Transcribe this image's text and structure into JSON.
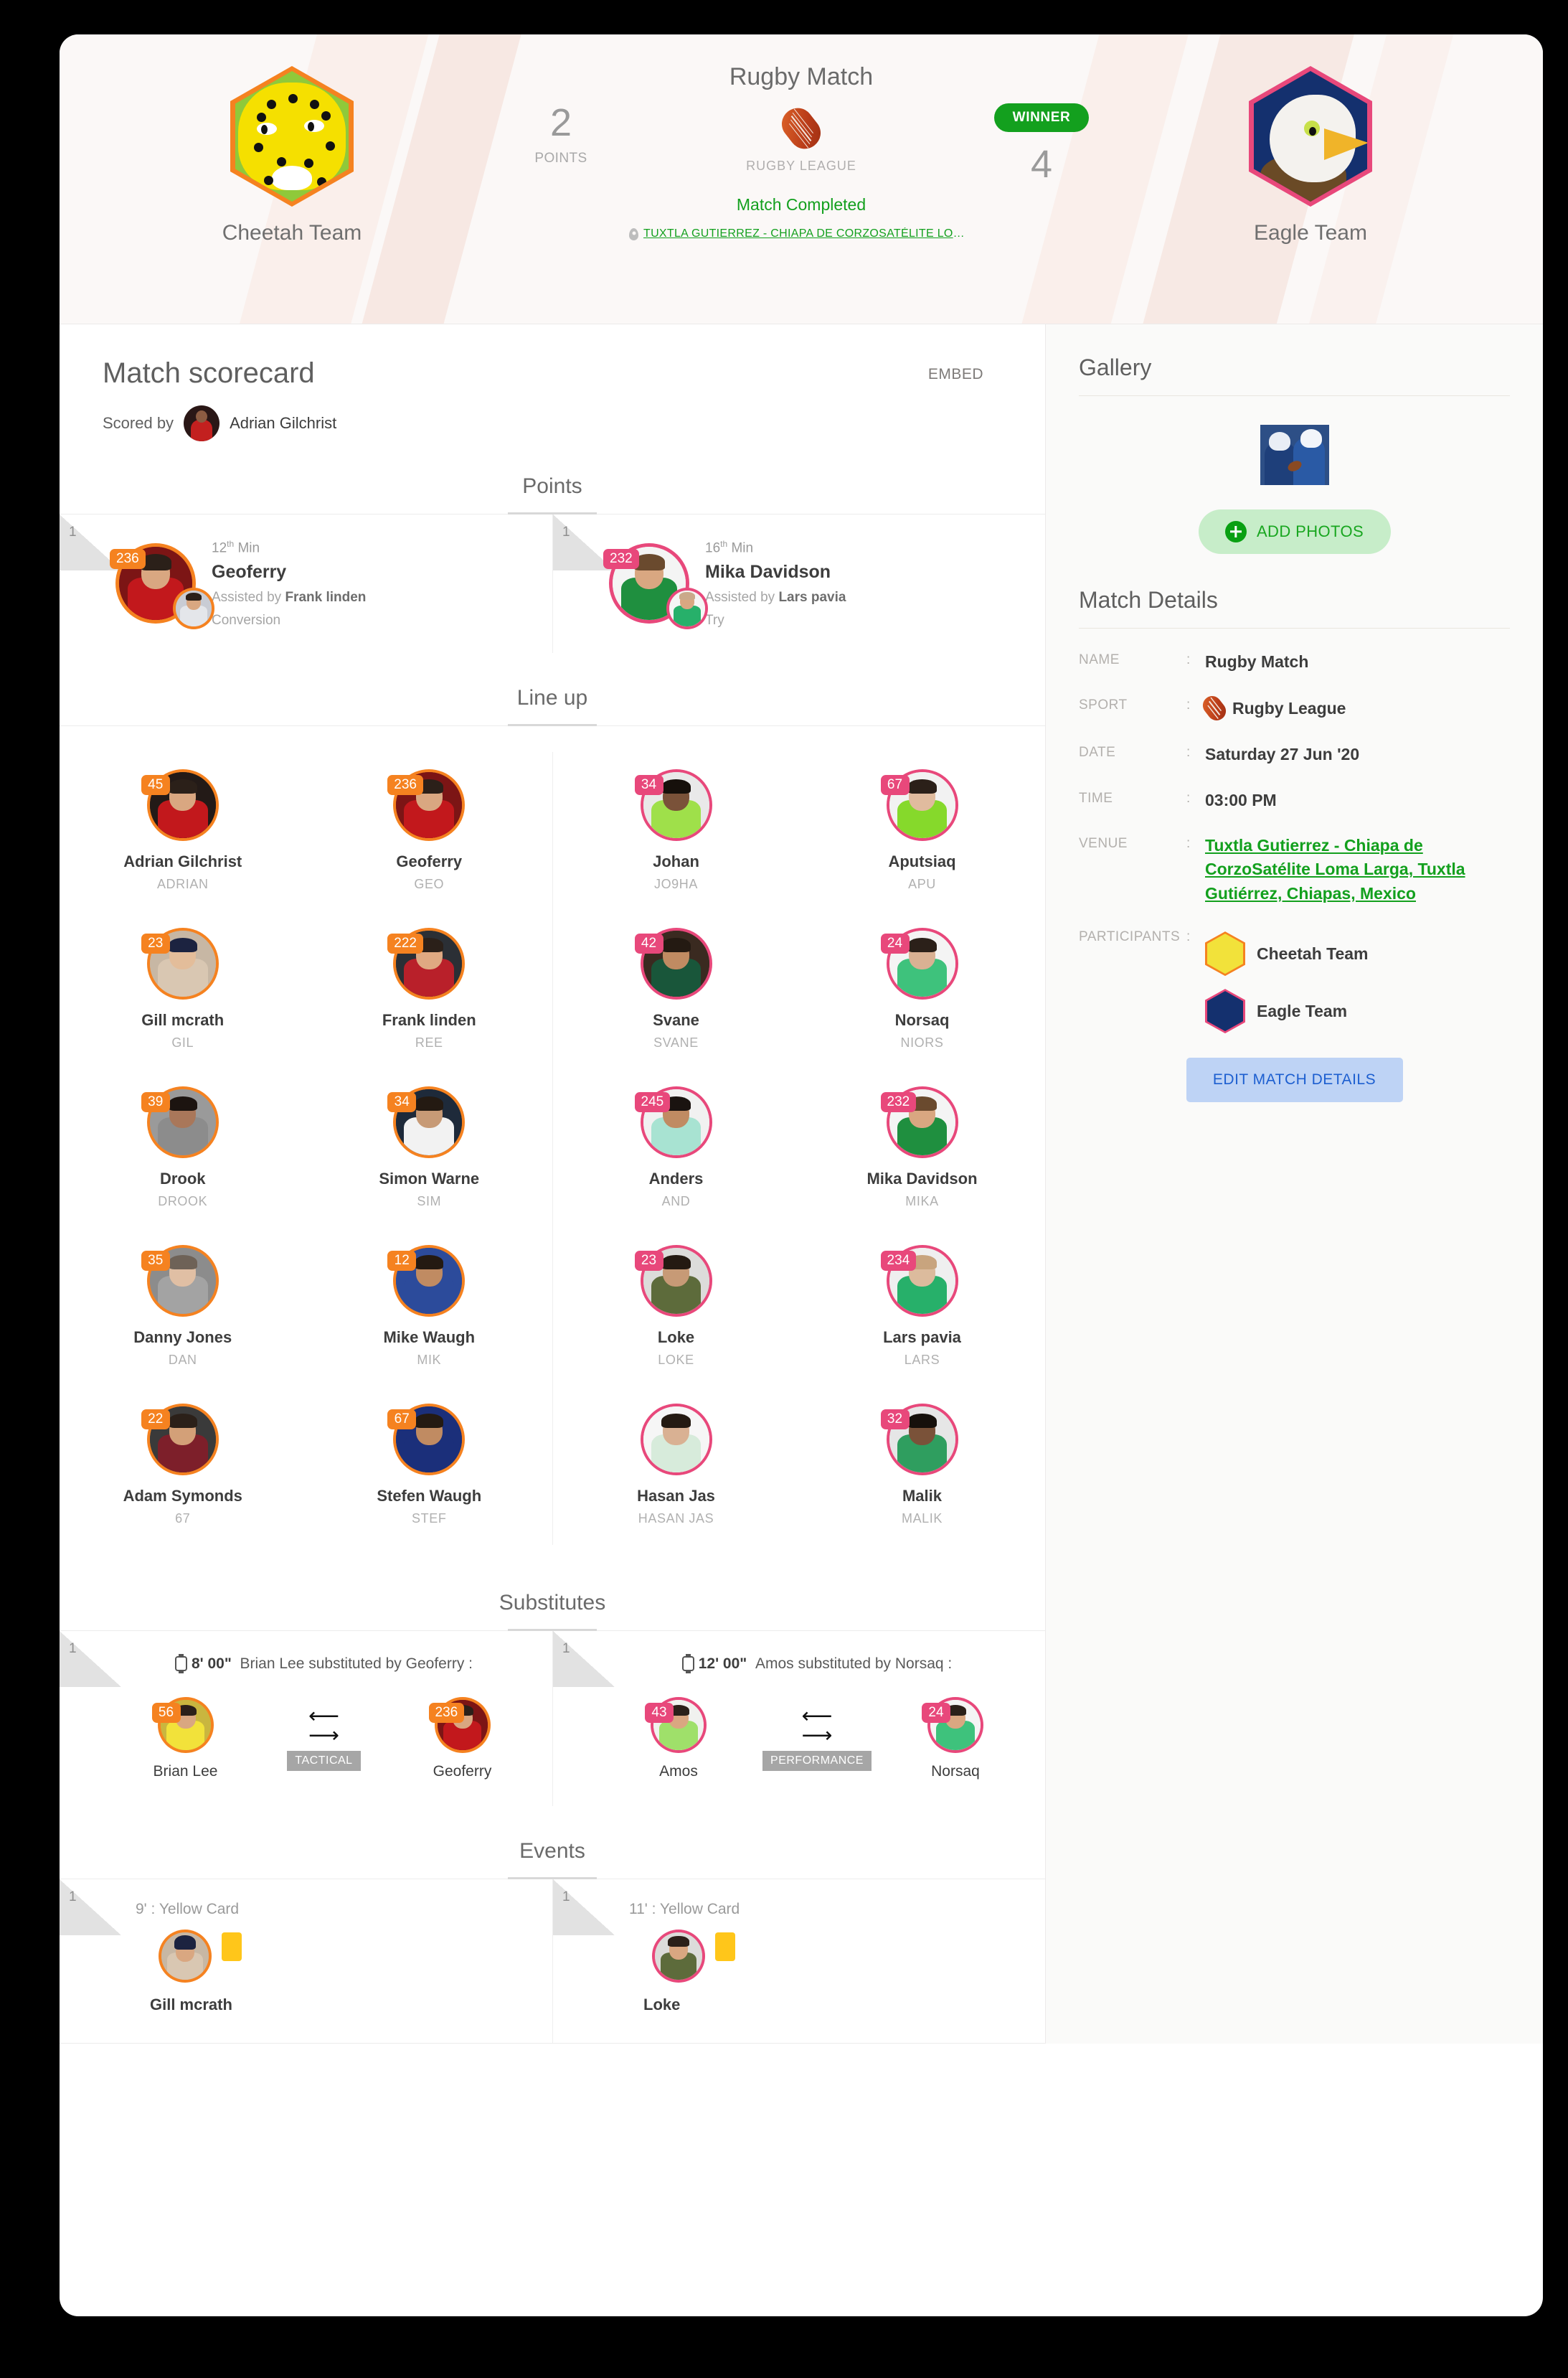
{
  "hero": {
    "match_title": "Rugby Match",
    "sport_label": "RUGBY LEAGUE",
    "status": "Match Completed",
    "venue_short": "TUXTLA GUTIERREZ - CHIAPA DE CORZOSATÉLITE LOMA LARG...",
    "winner_label": "WINNER",
    "home": {
      "name": "Cheetah Team",
      "score": "2",
      "score_label": "POINTS"
    },
    "away": {
      "name": "Eagle Team",
      "score": "4"
    }
  },
  "scorecard": {
    "title": "Match scorecard",
    "embed_label": "EMBED",
    "scored_by_label": "Scored by",
    "scorer_name": "Adrian Gilchrist"
  },
  "sections": {
    "points": "Points",
    "lineup": "Line up",
    "substitutes": "Substitutes",
    "events": "Events"
  },
  "points": [
    {
      "index": "1",
      "minute": "12",
      "minute_sup": "th",
      "minute_unit": "Min",
      "player": "Geoferry",
      "number": "236",
      "assist_prefix": "Assisted by",
      "assist_name": "Frank linden",
      "type": "Conversion",
      "team_color": "orange"
    },
    {
      "index": "1",
      "minute": "16",
      "minute_sup": "th",
      "minute_unit": "Min",
      "player": "Mika Davidson",
      "number": "232",
      "assist_prefix": "Assisted by",
      "assist_name": "Lars pavia",
      "type": "Try",
      "team_color": "pink"
    }
  ],
  "lineup": {
    "home": [
      {
        "number": "45",
        "name": "Adrian Gilchrist",
        "nick": "ADRIAN"
      },
      {
        "number": "236",
        "name": "Geoferry",
        "nick": "GEO"
      },
      {
        "number": "23",
        "name": "Gill mcrath",
        "nick": "GIL"
      },
      {
        "number": "222",
        "name": "Frank linden",
        "nick": "REE"
      },
      {
        "number": "39",
        "name": "Drook",
        "nick": "DROOK"
      },
      {
        "number": "34",
        "name": "Simon Warne",
        "nick": "SIM"
      },
      {
        "number": "35",
        "name": "Danny Jones",
        "nick": "DAN"
      },
      {
        "number": "12",
        "name": "Mike Waugh",
        "nick": "MIK"
      },
      {
        "number": "22",
        "name": "Adam Symonds",
        "nick": "67"
      },
      {
        "number": "67",
        "name": "Stefen Waugh",
        "nick": "STEF"
      }
    ],
    "away": [
      {
        "number": "34",
        "name": "Johan",
        "nick": "JO9HA"
      },
      {
        "number": "67",
        "name": "Aputsiaq",
        "nick": "APU"
      },
      {
        "number": "42",
        "name": "Svane",
        "nick": "SVANE"
      },
      {
        "number": "24",
        "name": "Norsaq",
        "nick": "NIORS"
      },
      {
        "number": "245",
        "name": "Anders",
        "nick": "AND"
      },
      {
        "number": "232",
        "name": "Mika Davidson",
        "nick": "MIKA"
      },
      {
        "number": "23",
        "name": "Loke",
        "nick": "LOKE"
      },
      {
        "number": "234",
        "name": "Lars pavia",
        "nick": "LARS"
      },
      {
        "number": "",
        "name": "Hasan Jas",
        "nick": "HASAN JAS"
      },
      {
        "number": "32",
        "name": "Malik",
        "nick": "MALIK"
      }
    ]
  },
  "substitutes": [
    {
      "index": "1",
      "time": "8' 00\"",
      "text": "Brian Lee substituted by Geoferry :",
      "out": {
        "name": "Brian Lee",
        "number": "56"
      },
      "in": {
        "name": "Geoferry",
        "number": "236"
      },
      "reason": "TACTICAL",
      "team_color": "orange"
    },
    {
      "index": "1",
      "time": "12' 00\"",
      "text": "Amos substituted by Norsaq :",
      "out": {
        "name": "Amos",
        "number": "43"
      },
      "in": {
        "name": "Norsaq",
        "number": "24"
      },
      "reason": "PERFORMANCE",
      "team_color": "pink"
    }
  ],
  "events": [
    {
      "index": "1",
      "time_type": "9' : Yellow Card",
      "player": "Gill mcrath",
      "team_color": "orange"
    },
    {
      "index": "1",
      "time_type": "11' : Yellow Card",
      "player": "Loke",
      "team_color": "pink"
    }
  ],
  "gallery": {
    "title": "Gallery",
    "add_photos_label": "ADD PHOTOS"
  },
  "match_details": {
    "title": "Match Details",
    "colon": ":",
    "keys": {
      "name": "NAME",
      "sport": "SPORT",
      "date": "DATE",
      "time": "TIME",
      "venue": "VENUE",
      "participants": "PARTICIPANTS"
    },
    "values": {
      "name": "Rugby Match",
      "sport": "Rugby League",
      "date": "Saturday 27 Jun '20",
      "time": "03:00 PM",
      "venue": "Tuxtla Gutierrez - Chiapa de CorzoSatélite Loma Larga, Tuxtla Gutiérrez, Chiapas, Mexico"
    },
    "participants": [
      {
        "name": "Cheetah Team",
        "color": "orange"
      },
      {
        "name": "Eagle Team",
        "color": "pink"
      }
    ],
    "edit_button": "EDIT MATCH DETAILS"
  },
  "colors": {
    "home_accent": "#f58220",
    "away_accent": "#e8487b",
    "success": "#13a01e",
    "link": "#1d5fd0",
    "card_yellow": "#ffc61a"
  }
}
